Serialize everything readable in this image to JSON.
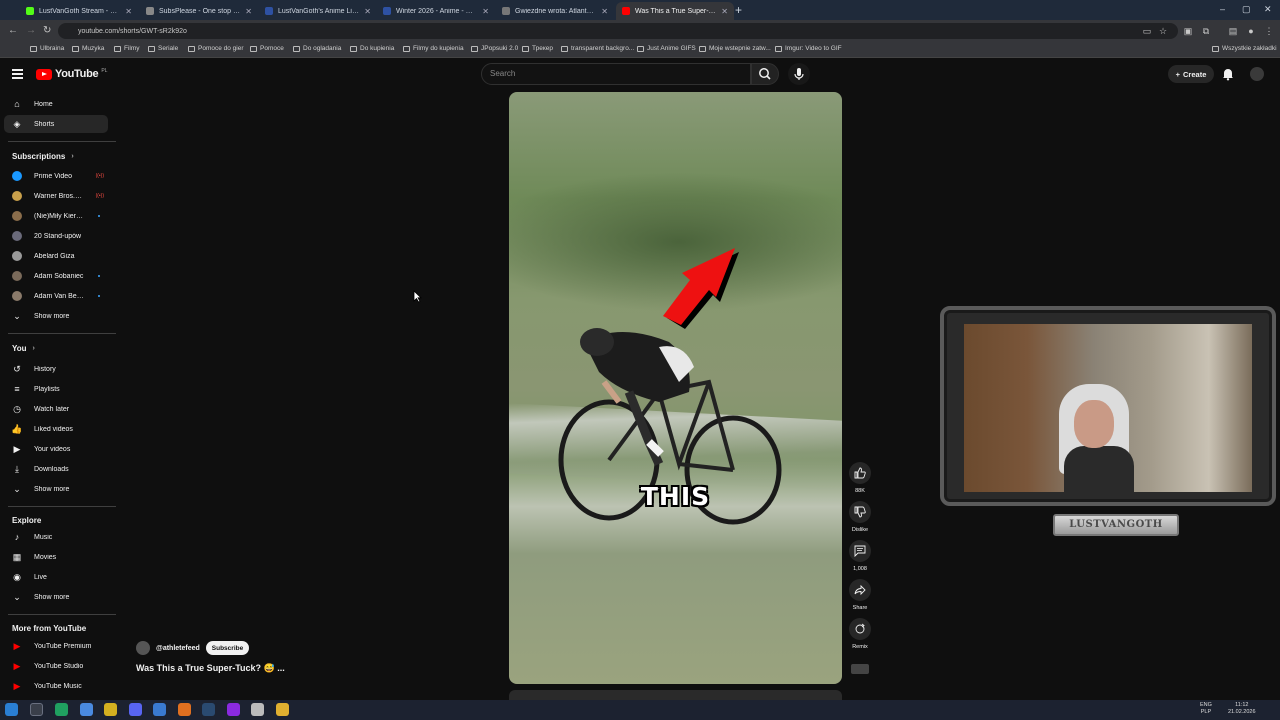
{
  "browser": {
    "tabs": [
      {
        "title": "LustVanGoth Stream - Watch Li",
        "favicon_color": "#53fc18",
        "active": false
      },
      {
        "title": "SubsPlease - One stop shop fo",
        "favicon_color": "#888888",
        "active": false
      },
      {
        "title": "LustVanGoth's Anime List - My",
        "favicon_color": "#2e51a2",
        "active": false
      },
      {
        "title": "Winter 2026 - Anime - MyAnim",
        "favicon_color": "#2e51a2",
        "active": false
      },
      {
        "title": "Gwiezdne wrota: Atlantyda / St",
        "favicon_color": "#777777",
        "active": false
      },
      {
        "title": "Was This a True Super-Tuck?",
        "favicon_color": "#ff0000",
        "active": true
      }
    ],
    "url": "youtube.com/shorts/GWT-sR2k92o",
    "bookmarks": [
      "Ulbraina",
      "Muzyka",
      "Filmy",
      "Seriale",
      "Pomoce do gier",
      "Pomoce",
      "Do ogladania",
      "Do kupienia",
      "Filmy do kupienia",
      "JPopsuki 2.0",
      "Трекер",
      "transparent backgro...",
      "Just Anime GIFS",
      "Moje wstepnie zatw...",
      "Imgur: Video to GIF"
    ],
    "bookmarks_right": "Wszystkie zakładki"
  },
  "header": {
    "logo_text": "YouTube",
    "country_code": "PL",
    "search_placeholder": "Search",
    "create_label": "Create"
  },
  "sidebar": {
    "main": [
      {
        "label": "Home",
        "icon": "home-icon"
      },
      {
        "label": "Shorts",
        "icon": "shorts-icon",
        "active": true
      }
    ],
    "subscriptions_title": "Subscriptions",
    "subscriptions": [
      {
        "label": "Prime Video",
        "color": "#1a98ff",
        "badge": "live"
      },
      {
        "label": "Warner Bros. Ent...",
        "color": "#c9a04b",
        "badge": "live"
      },
      {
        "label": "(Nie)Miły Kierow...",
        "color": "#8a6d4b",
        "badge": "new"
      },
      {
        "label": "20 Stand-upów",
        "color": "#6a6a7a"
      },
      {
        "label": "Abelard Giza",
        "color": "#9a9a9a"
      },
      {
        "label": "Adam Sobaniec",
        "color": "#7a6a5a",
        "badge": "new"
      },
      {
        "label": "Adam Van Bendl...",
        "color": "#8a7a6a",
        "badge": "new"
      }
    ],
    "show_more_1": "Show more",
    "you_title": "You",
    "you_items": [
      {
        "label": "History",
        "icon": "history-icon"
      },
      {
        "label": "Playlists",
        "icon": "playlists-icon"
      },
      {
        "label": "Watch later",
        "icon": "watch-later-icon"
      },
      {
        "label": "Liked videos",
        "icon": "like-icon"
      },
      {
        "label": "Your videos",
        "icon": "your-videos-icon"
      },
      {
        "label": "Downloads",
        "icon": "download-icon"
      }
    ],
    "show_more_2": "Show more",
    "explore_title": "Explore",
    "explore_items": [
      {
        "label": "Music",
        "icon": "music-icon"
      },
      {
        "label": "Movies",
        "icon": "movies-icon"
      },
      {
        "label": "Live",
        "icon": "live-icon"
      }
    ],
    "show_more_3": "Show more",
    "more_title": "More from YouTube",
    "more_items": [
      {
        "label": "YouTube Premium"
      },
      {
        "label": "YouTube Studio"
      },
      {
        "label": "YouTube Music"
      }
    ]
  },
  "short": {
    "caption": "THIS",
    "channel": "@athletefeed",
    "subscribe_label": "Subscribe",
    "title": "Was This a True Super-Tuck? 😅 ..."
  },
  "actions": {
    "likes": "88K",
    "dislike": "Dislike",
    "comments": "1,008",
    "share": "Share",
    "remix": "Remix"
  },
  "overlay": {
    "nameplate": "LUSTVANGOTH"
  },
  "taskbar": {
    "lang": "ENG",
    "lang2": "PLP",
    "time": "11:12",
    "date": "21.02.2026"
  }
}
